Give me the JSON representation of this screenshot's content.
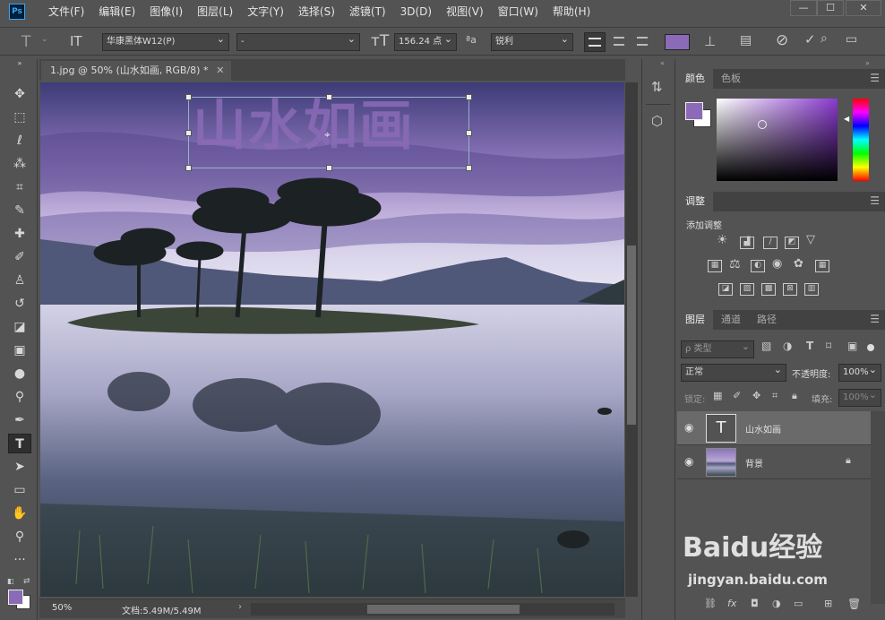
{
  "app": {
    "logo_text": "Ps"
  },
  "menu": [
    "文件(F)",
    "编辑(E)",
    "图像(I)",
    "图层(L)",
    "文字(Y)",
    "选择(S)",
    "滤镜(T)",
    "3D(D)",
    "视图(V)",
    "窗口(W)",
    "帮助(H)"
  ],
  "options": {
    "font_family": "华康黑体W12(P)",
    "font_style": "-",
    "font_size": "156.24 点",
    "aa_label": "ªa",
    "antialias": "锐利",
    "text_color": "#8b6bb7"
  },
  "document": {
    "tab_title": "1.jpg @ 50% (山水如画, RGB/8) *",
    "overlay_text": "山水如画",
    "zoom": "50%",
    "doc_info": "文档:5.49M/5.49M"
  },
  "color_panel": {
    "tabs": [
      "颜色",
      "色板"
    ],
    "fg_color": "#8b6bb7",
    "bg_color": "#ffffff"
  },
  "adjust_panel": {
    "tab": "调整",
    "heading": "添加调整"
  },
  "layers_panel": {
    "tabs": [
      "图层",
      "通道",
      "路径"
    ],
    "filter_label": "ρ 类型",
    "blend_mode": "正常",
    "opacity_label": "不透明度:",
    "opacity_value": "100%",
    "lock_label": "锁定:",
    "fill_label": "填充:",
    "fill_value": "100%",
    "layers": [
      {
        "name": "山水如画",
        "type": "text"
      },
      {
        "name": "背景",
        "type": "image"
      }
    ]
  },
  "watermark": {
    "line1": "Baidu经验",
    "line2": "jingyan.baidu.com"
  }
}
